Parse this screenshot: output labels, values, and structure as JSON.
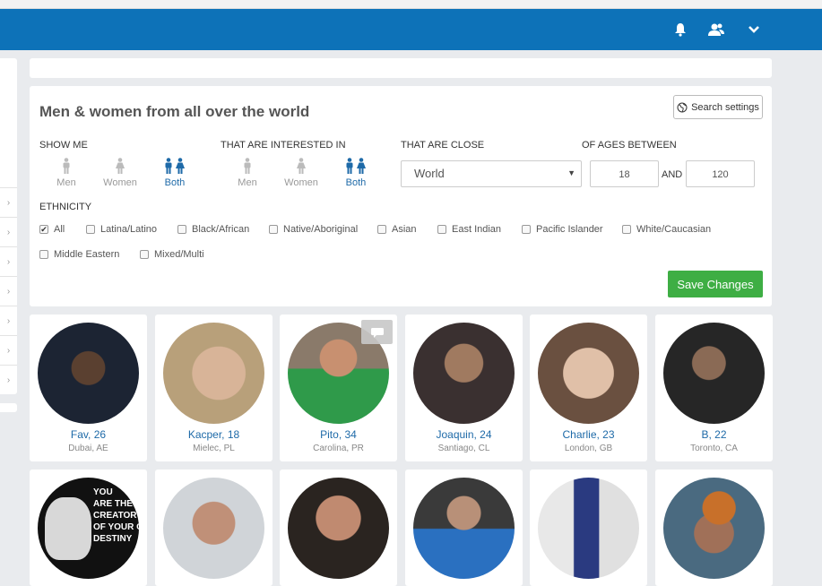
{
  "navbar": {
    "icons": [
      "bell-icon",
      "friends-icon",
      "chevron-down-icon"
    ],
    "color": "#0d72b8"
  },
  "panel": {
    "title": "Men & women from all over the world",
    "search_settings_label": "Search settings",
    "show_me_label": "SHOW ME",
    "interested_label": "THAT ARE INTERESTED IN",
    "close_label": "THAT ARE CLOSE",
    "ages_label": "OF AGES BETWEEN",
    "show_me_options": [
      {
        "label": "Men",
        "active": false
      },
      {
        "label": "Women",
        "active": false
      },
      {
        "label": "Both",
        "active": true
      }
    ],
    "interested_options": [
      {
        "label": "Men",
        "active": false
      },
      {
        "label": "Women",
        "active": false
      },
      {
        "label": "Both",
        "active": true
      }
    ],
    "location_value": "World",
    "age_min": "18",
    "age_and": "AND",
    "age_max": "120",
    "ethnicity_label": "ETHNICITY",
    "ethnicities": [
      {
        "label": "All",
        "checked": true
      },
      {
        "label": "Latina/Latino",
        "checked": false
      },
      {
        "label": "Black/African",
        "checked": false
      },
      {
        "label": "Native/Aboriginal",
        "checked": false
      },
      {
        "label": "Asian",
        "checked": false
      },
      {
        "label": "East Indian",
        "checked": false
      },
      {
        "label": "Pacific Islander",
        "checked": false
      },
      {
        "label": "White/Caucasian",
        "checked": false
      },
      {
        "label": "Middle Eastern",
        "checked": false
      },
      {
        "label": "Mixed/Multi",
        "checked": false
      }
    ],
    "save_label": "Save Changes",
    "save_color": "#3eae44"
  },
  "profiles_row1": [
    {
      "name": "Fav, 26",
      "location": "Dubai, AE"
    },
    {
      "name": "Kacper, 18",
      "location": "Mielec, PL"
    },
    {
      "name": "Pito, 34",
      "location": "Carolina, PR"
    },
    {
      "name": "Joaquin, 24",
      "location": "Santiago, CL"
    },
    {
      "name": "Charlie, 23",
      "location": "London, GB"
    },
    {
      "name": "B, 22",
      "location": "Toronto, CA"
    }
  ],
  "profiles_row2_poster_text": [
    "YOU",
    "ARE THE",
    "CREATOR",
    "OF YOUR OWN",
    "DESTINY"
  ],
  "accent_color": "#1e6aa8"
}
